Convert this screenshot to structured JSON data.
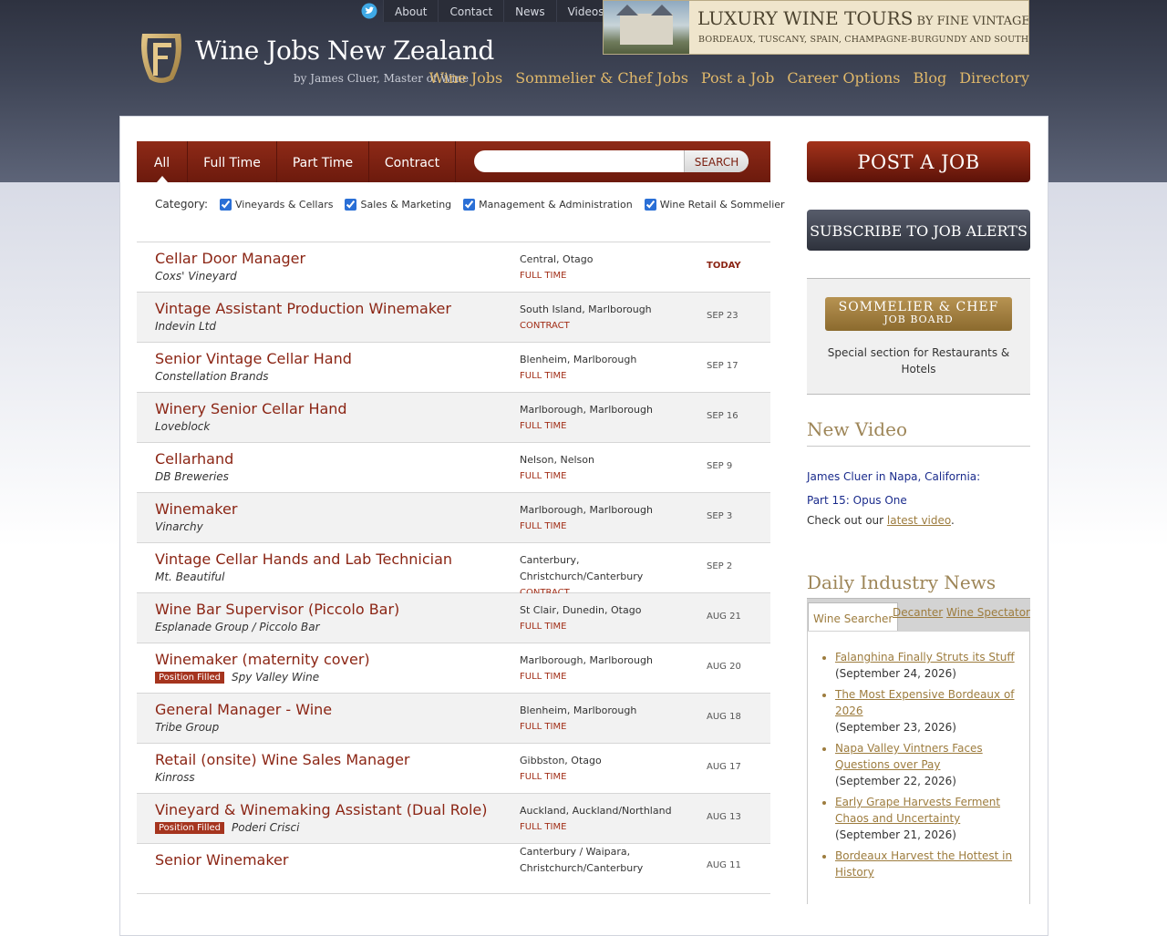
{
  "site": {
    "title": "Wine Jobs New Zealand",
    "subtitle": "by James Cluer, Master of Wine"
  },
  "topnav": [
    "About",
    "Contact",
    "News",
    "Videos"
  ],
  "banner": {
    "headline": "LUXURY WINE TOURS",
    "headline_small": " BY FINE VINTAGE LTD",
    "regions": "BORDEAUX, TUSCANY, SPAIN, CHAMPAGNE-BURGUNDY AND SOUTH AFRICA"
  },
  "mainnav": [
    "Wine Jobs",
    "Sommelier & Chef Jobs",
    "Post a Job",
    "Career Options",
    "Blog",
    "Directory"
  ],
  "filters": {
    "tabs": [
      "All",
      "Full Time",
      "Part Time",
      "Contract"
    ],
    "search_button": "SEARCH",
    "search_value": "",
    "category_label": "Category:",
    "categories": [
      "Vineyards & Cellars",
      "Sales & Marketing",
      "Management & Administration",
      "Wine Retail & Sommelier"
    ]
  },
  "jobs": [
    {
      "title": "Cellar Door Manager",
      "company": "Coxs' Vineyard",
      "location": "Central, Otago",
      "type": "FULL TIME",
      "date": "TODAY",
      "filled": ""
    },
    {
      "title": "Vintage Assistant Production Winemaker",
      "company": "Indevin Ltd",
      "location": "South Island, Marlborough",
      "type": "CONTRACT",
      "date": "SEP 23",
      "filled": ""
    },
    {
      "title": "Senior Vintage Cellar Hand",
      "company": "Constellation Brands",
      "location": "Blenheim, Marlborough",
      "type": "FULL TIME",
      "date": "SEP 17",
      "filled": ""
    },
    {
      "title": "Winery Senior Cellar Hand",
      "company": "Loveblock",
      "location": "Marlborough, Marlborough",
      "type": "FULL TIME",
      "date": "SEP 16",
      "filled": ""
    },
    {
      "title": "Cellarhand",
      "company": "DB Breweries",
      "location": "Nelson, Nelson",
      "type": "FULL TIME",
      "date": "SEP 9",
      "filled": ""
    },
    {
      "title": "Winemaker",
      "company": "Vinarchy",
      "location": "Marlborough, Marlborough",
      "type": "FULL TIME",
      "date": "SEP 3",
      "filled": ""
    },
    {
      "title": "Vintage Cellar Hands and Lab Technician",
      "company": "Mt. Beautiful",
      "location": "Canterbury, Christchurch/Canterbury",
      "type": "CONTRACT",
      "date": "SEP 2",
      "filled": ""
    },
    {
      "title": "Wine Bar Supervisor (Piccolo Bar)",
      "company": "Esplanade Group / Piccolo Bar",
      "location": "St Clair, Dunedin, Otago",
      "type": "FULL TIME",
      "date": "AUG 21",
      "filled": ""
    },
    {
      "title": "Winemaker (maternity cover)",
      "company": "Spy Valley Wine",
      "location": "Marlborough, Marlborough",
      "type": "FULL TIME",
      "date": "AUG 20",
      "filled": "Position Filled"
    },
    {
      "title": "General Manager - Wine",
      "company": "Tribe Group",
      "location": "Blenheim, Marlborough",
      "type": "FULL TIME",
      "date": "AUG 18",
      "filled": ""
    },
    {
      "title": "Retail (onsite) Wine Sales Manager",
      "company": "Kinross",
      "location": "Gibbston, Otago",
      "type": "FULL TIME",
      "date": "AUG 17",
      "filled": ""
    },
    {
      "title": "Vineyard & Winemaking Assistant (Dual Role)",
      "company": "Poderi Crisci",
      "location": "Auckland, Auckland/Northland",
      "type": "FULL TIME",
      "date": "AUG 13",
      "filled": "Position Filled"
    },
    {
      "title": "Senior Winemaker",
      "company": "",
      "location": "Canterbury / Waipara, Christchurch/Canterbury",
      "type": "",
      "date": "AUG 11",
      "filled": ""
    }
  ],
  "sidebar": {
    "post_job": "POST A JOB",
    "subscribe": "SUBSCRIBE TO JOB ALERTS",
    "sommelier_line1": "SOMMELIER & CHEF",
    "sommelier_line2": "JOB BOARD",
    "sommelier_text": "Special section for Restaurants & Hotels",
    "video_heading": "New Video",
    "video_link": "James Cluer in Napa, California:",
    "video_link2": "Part 15: Opus One",
    "video_more_prefix": "Check out our ",
    "video_more_link": "latest video",
    "video_more_suffix": ".",
    "news_heading": "Daily Industry News",
    "news_tabs": [
      "Wine Searcher",
      "Decanter",
      "Wine Spectator"
    ],
    "news": [
      {
        "title": "Falanghina Finally Struts its Stuff",
        "date": "(September 24, 2026)"
      },
      {
        "title": "The Most Expensive Bordeaux of 2026",
        "date": "(September 23, 2026)"
      },
      {
        "title": "Napa Valley Vintners Faces Questions over Pay",
        "date": "(September 22, 2026)"
      },
      {
        "title": "Early Grape Harvests Ferment Chaos and Uncertainty",
        "date": "(September 21, 2026)"
      },
      {
        "title": "Bordeaux Harvest the Hottest in History",
        "date": ""
      }
    ]
  }
}
